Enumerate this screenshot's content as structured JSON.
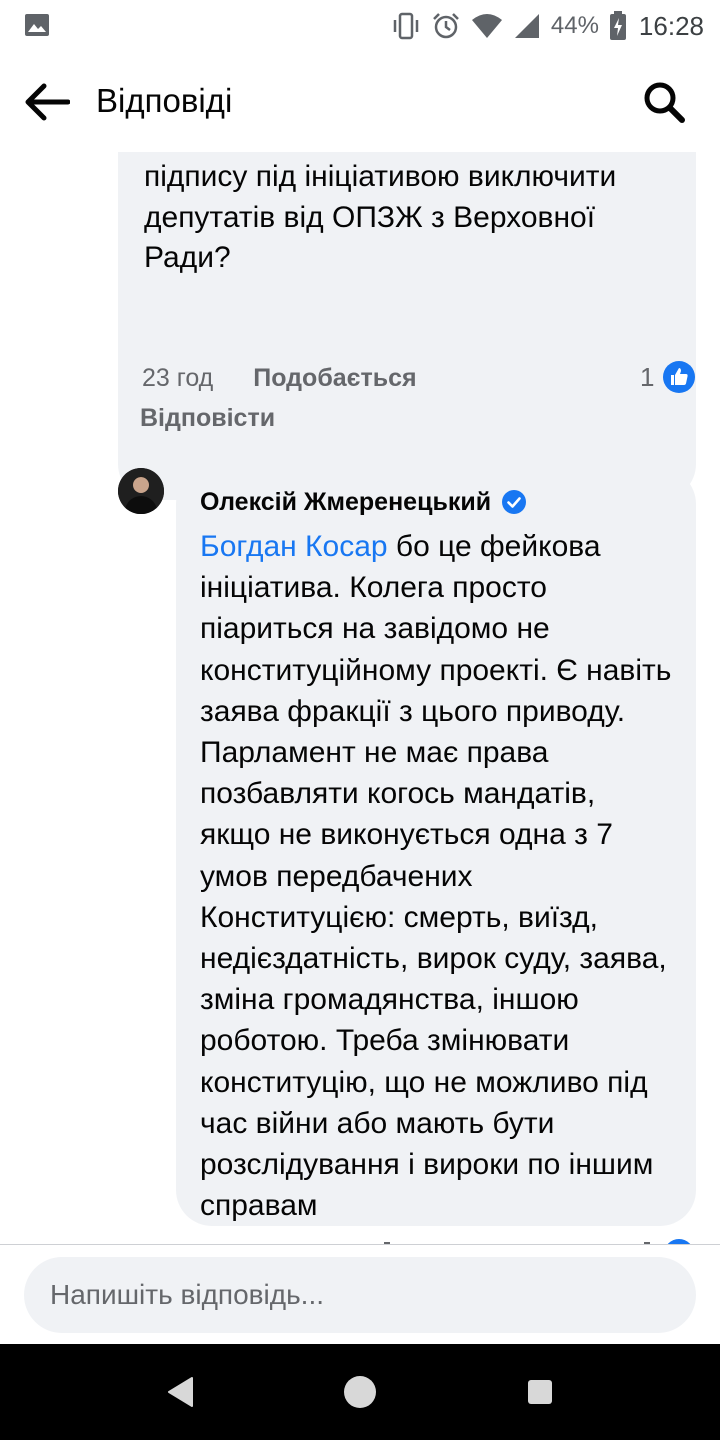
{
  "status_bar": {
    "battery_percent": "44%",
    "time": "16:28",
    "icons": [
      "gallery-icon",
      "vibrate-icon",
      "alarm-icon",
      "wifi-icon",
      "signal-icon",
      "battery-charging-icon"
    ]
  },
  "header": {
    "title": "Відповіді",
    "back_icon": "arrow-left-icon",
    "search_icon": "search-icon"
  },
  "comment": {
    "text": "підтримуєте. Україну чи її зрадників. Чому до цього часу нема вашого підпису під ініціативою виключити депутатів від ОПЗЖ з Верховної Ради?",
    "time": "23 год",
    "like_label": "Подобається",
    "reply_label": "Відповісти",
    "reaction_count": "1",
    "reaction_icon": "like-reaction-icon"
  },
  "reply": {
    "author": "Олексій Жмеренецький",
    "verified": true,
    "mention": "Богдан Косар",
    "text": " бо це фейкова ініціатива. Колега просто піариться на завідомо не конституційному проекті. Є навіть заява фракції з цього приводу. Парламент не має права позбавляти когось мандатів, якщо не виконується одна з 7 умов передбачених Конституцією: смерть, виїзд, недієздатність, вирок суду, заява, зміна громадянства, іншою роботою. Треба змінювати конституцію, що не можливо під час війни або мають бути розслідування і вироки по іншим справам"
  },
  "reply_bar": {
    "placeholder": "Напишіть відповідь..."
  },
  "colors": {
    "accent": "#1877f2",
    "bubble": "#f0f2f5",
    "secondary_text": "#65676b"
  }
}
